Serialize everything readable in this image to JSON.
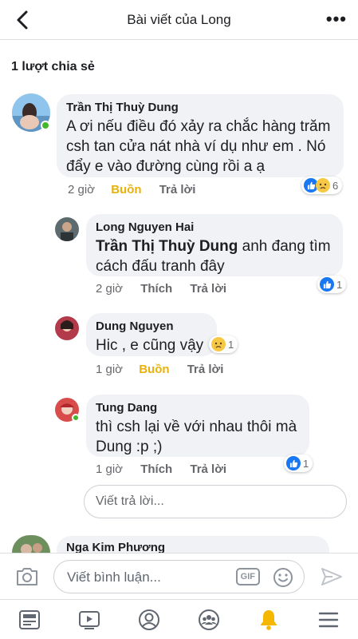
{
  "header": {
    "title": "Bài viết của Long"
  },
  "shares_label": "1 lượt chia sẻ",
  "comments": [
    {
      "name": "Trần Thị Thuỳ Dung",
      "text": "A ơi nếu điều đó xảy ra chắc hàng trăm csh tan cửa nát nhà ví dụ như em . Nó đẩy e vào đường cùng rồi a ạ",
      "time": "2 giờ",
      "reaction_label": "Buồn",
      "reply_label": "Trả lời",
      "reaction_count": "6"
    },
    {
      "name": "Long Nguyen Hai",
      "mention": "Trần Thị Thuỳ Dung",
      "text": " anh đang tìm cách đấu tranh đây",
      "time": "2 giờ",
      "reaction_label": "Thích",
      "reply_label": "Trả lời",
      "reaction_count": "1"
    },
    {
      "name": "Dung Nguyen",
      "text": "Hic , e cũng vậy",
      "time": "1 giờ",
      "reaction_label": "Buồn",
      "reply_label": "Trả lời",
      "reaction_count": "1"
    },
    {
      "name": "Tung Dang",
      "text": "thì csh lại về với nhau thôi mà Dung :p ;)",
      "time": "1 giờ",
      "reaction_label": "Thích",
      "reply_label": "Trả lời",
      "reaction_count": "1"
    },
    {
      "name": "Nga Kim Phương"
    }
  ],
  "reply_placeholder": "Viết trả lời...",
  "composer": {
    "placeholder": "Viết bình luận...",
    "gif_label": "GIF"
  },
  "colors": {
    "like_blue": "#1877f2",
    "sad_yellow": "#e9b10b",
    "online_green": "#42b72a"
  }
}
